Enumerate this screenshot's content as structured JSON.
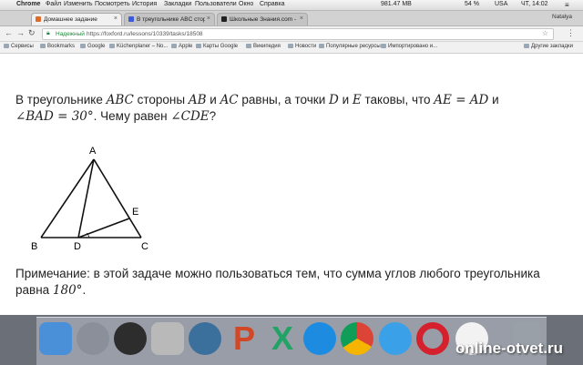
{
  "menubar": {
    "app": "Chrome",
    "menus": [
      "Файл",
      "Изменить",
      "Посмотреть",
      "История",
      "Закладки",
      "Пользователи",
      "Окно",
      "Справка"
    ],
    "status": {
      "memory": "981.47 MB",
      "battery": "54 %",
      "locale": "USA",
      "clock": "ЧТ, 14:02"
    },
    "user": "Natalya"
  },
  "tabs": [
    {
      "title": "Домашнее задание",
      "active": true,
      "favicon_color": "#e06a2a"
    },
    {
      "title": "В треугольнике ABC сторон...",
      "active": false,
      "favicon_color": "#3b5bdb"
    },
    {
      "title": "Школьные Знания.com - Реш...",
      "active": false,
      "favicon_color": "#222222"
    }
  ],
  "toolbar": {
    "secure_label": "Надежный",
    "url": "https://foxford.ru/lessons/10339/tasks/18508"
  },
  "bookmarks": {
    "items": [
      "Сервисы",
      "Bookmarks",
      "Google",
      "Küchenplaner – No...",
      "Apple",
      "Карты Google",
      "Википедия",
      "Новости",
      "Популярные ресурсы",
      "Импортировано и..."
    ],
    "other": "Другие закладки"
  },
  "problem": {
    "p1": "В треугольнике ",
    "abc": "ABC",
    "p2": " стороны ",
    "ab": "AB",
    "p3": " и ",
    "ac": "AC",
    "p4": " равны, а точки ",
    "d": "D",
    "p5": " и ",
    "e": "E",
    "p6": " таковы, что ",
    "eq1": "AE = AD",
    "p7": " и",
    "eq2": "∠BAD = 30°",
    "p8": ". Чему равен ",
    "q": "∠CDE",
    "p9": "?"
  },
  "figure": {
    "A": "A",
    "B": "B",
    "C": "C",
    "D": "D",
    "E": "E"
  },
  "note": {
    "text": "Примечание: в этой задаче можно пользоваться тем, что сумма углов любого треугольника равна ",
    "value": "180°",
    "end": "."
  },
  "dock": {
    "icons": [
      "finder-icon",
      "launchpad-icon",
      "dashboard-icon",
      "preview-icon",
      "time-machine-icon",
      "powerpoint-icon",
      "excel-icon",
      "app-store-icon",
      "chrome-icon",
      "safari-icon",
      "opera-icon",
      "itunes-icon",
      "trash-icon"
    ],
    "colors": [
      "#4a90d9",
      "#8a8f99",
      "#2d2d2d",
      "#b9b9b9",
      "#3b6f9c",
      "#d24726",
      "#21a366",
      "#1d8ce0",
      "#e8e8e8",
      "#3aa0e8",
      "#d4212d",
      "#f2f2f2",
      "#9aa0a8"
    ]
  },
  "watermark": "online-otvet.ru"
}
